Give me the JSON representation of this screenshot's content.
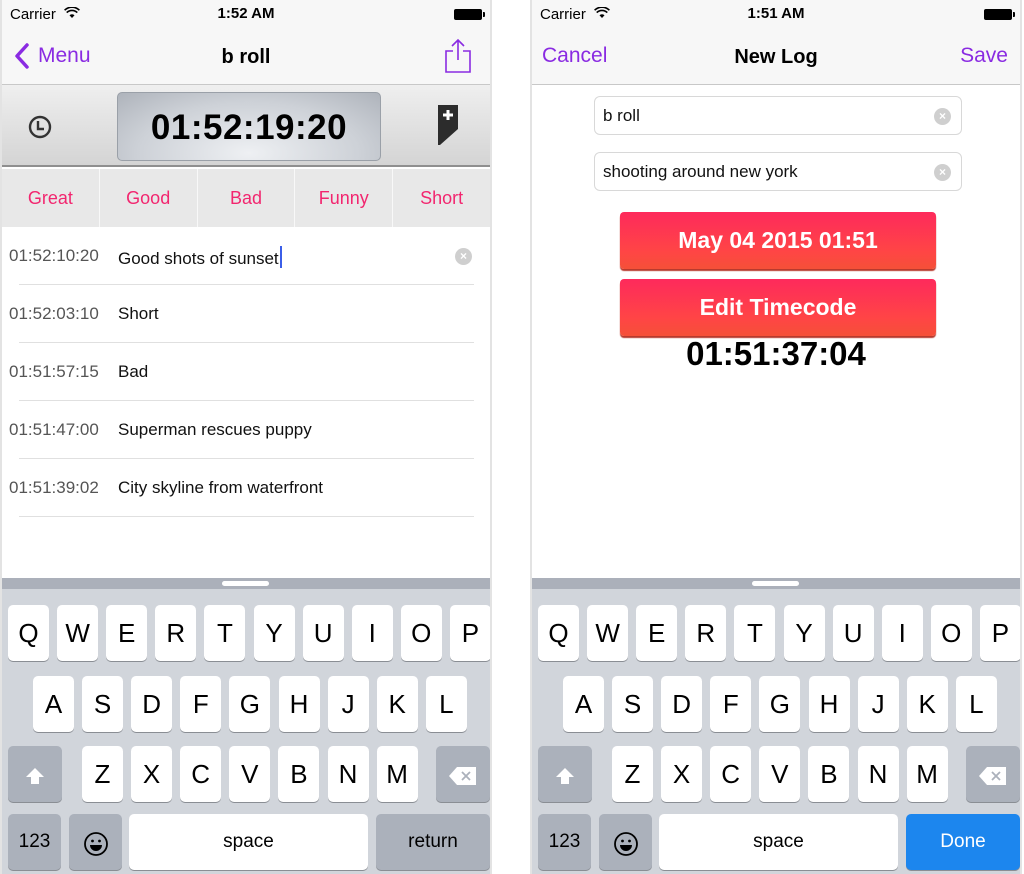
{
  "left_screen": {
    "status": {
      "carrier": "Carrier",
      "time": "1:52 AM"
    },
    "nav": {
      "back_label": "Menu",
      "title": "b roll"
    },
    "timecode": "01:52:19:20",
    "tags": [
      "Great",
      "Good",
      "Bad",
      "Funny",
      "Short"
    ],
    "logs": [
      {
        "tc": "01:52:10:20",
        "text": "Good shots of sunset"
      },
      {
        "tc": "01:52:03:10",
        "text": "Short"
      },
      {
        "tc": "01:51:57:15",
        "text": "Bad"
      },
      {
        "tc": "01:51:47:00",
        "text": "Superman rescues puppy"
      },
      {
        "tc": "01:51:39:02",
        "text": "City skyline from waterfront"
      }
    ],
    "keyboard": {
      "row1": [
        "Q",
        "W",
        "E",
        "R",
        "T",
        "Y",
        "U",
        "I",
        "O",
        "P"
      ],
      "row2": [
        "A",
        "S",
        "D",
        "F",
        "G",
        "H",
        "J",
        "K",
        "L"
      ],
      "row3": [
        "Z",
        "X",
        "C",
        "V",
        "B",
        "N",
        "M"
      ],
      "numbers_label": "123",
      "space_label": "space",
      "action_label": "return"
    }
  },
  "right_screen": {
    "status": {
      "carrier": "Carrier",
      "time": "1:51 AM"
    },
    "nav": {
      "cancel_label": "Cancel",
      "title": "New Log",
      "save_label": "Save"
    },
    "fields": {
      "name_value": "b roll",
      "description_value": "shooting around new york"
    },
    "date_button_label": "May 04 2015 01:51",
    "edit_timecode_label": "Edit Timecode",
    "timecode": "01:51:37:04",
    "keyboard": {
      "row1": [
        "Q",
        "W",
        "E",
        "R",
        "T",
        "Y",
        "U",
        "I",
        "O",
        "P"
      ],
      "row2": [
        "A",
        "S",
        "D",
        "F",
        "G",
        "H",
        "J",
        "K",
        "L"
      ],
      "row3": [
        "Z",
        "X",
        "C",
        "V",
        "B",
        "N",
        "M"
      ],
      "numbers_label": "123",
      "space_label": "space",
      "action_label": "Done"
    }
  },
  "colors": {
    "accent": "#8a2be2",
    "tag": "#f2266f",
    "red_button": "#ff3a4f",
    "done_key": "#1c86ee"
  }
}
